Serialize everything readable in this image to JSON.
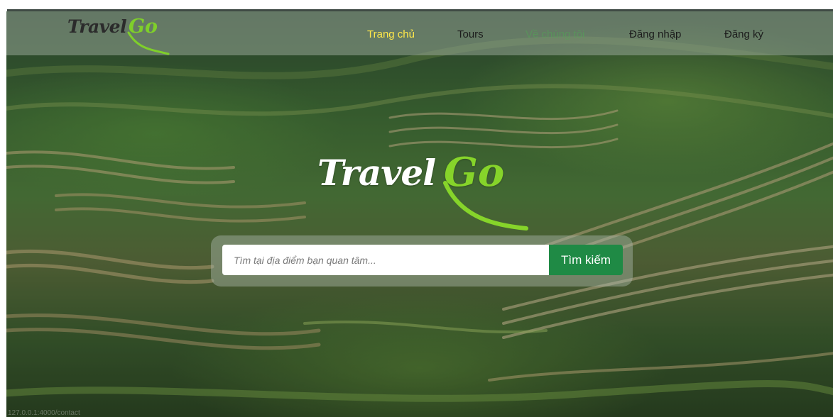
{
  "brand": {
    "word1": "Travel",
    "word2": "Go",
    "accent": "#7fcf2a"
  },
  "nav": {
    "items": [
      {
        "label": "Trang chủ",
        "state": "active"
      },
      {
        "label": "Tours",
        "state": "normal"
      },
      {
        "label": "Về chúng tôi",
        "state": "faded"
      },
      {
        "label": "Đăng nhập",
        "state": "normal"
      },
      {
        "label": "Đăng ký",
        "state": "normal"
      }
    ],
    "active_color": "#ffe84a"
  },
  "hero": {
    "logo_word1": "Travel",
    "logo_word2": "Go"
  },
  "search": {
    "placeholder": "Tìm tại địa điểm bạn quan tâm...",
    "value": "",
    "button_label": "Tìm kiếm",
    "button_color": "#1f8a45"
  },
  "status_bar": {
    "url": "127.0.0.1:4000/contact"
  }
}
